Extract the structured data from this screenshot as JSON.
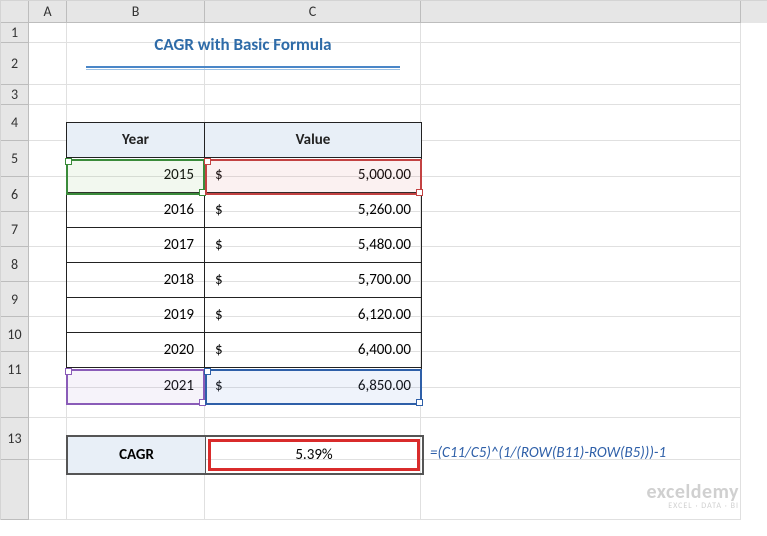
{
  "columns": {
    "A": "A",
    "B": "B",
    "C": "C"
  },
  "row_headers": [
    "1",
    "2",
    "3",
    "4",
    "5",
    "6",
    "7",
    "8",
    "9",
    "10",
    "11",
    "",
    "13"
  ],
  "title": "CAGR with Basic Formula",
  "table": {
    "headers": {
      "year": "Year",
      "value": "Value"
    },
    "rows": [
      {
        "year": "2015",
        "sym": "$",
        "value": "5,000.00"
      },
      {
        "year": "2016",
        "sym": "$",
        "value": "5,260.00"
      },
      {
        "year": "2017",
        "sym": "$",
        "value": "5,480.00"
      },
      {
        "year": "2018",
        "sym": "$",
        "value": "5,700.00"
      },
      {
        "year": "2019",
        "sym": "$",
        "value": "6,120.00"
      },
      {
        "year": "2020",
        "sym": "$",
        "value": "6,400.00"
      },
      {
        "year": "2021",
        "sym": "$",
        "value": "6,850.00"
      }
    ]
  },
  "cagr": {
    "label": "CAGR",
    "value": "5.39%"
  },
  "formula": "=(C11/C5)^(1/(ROW(B11)-ROW(B5)))-1",
  "watermark": {
    "brand": "exceldemy",
    "tagline": "EXCEL · DATA · BI"
  }
}
